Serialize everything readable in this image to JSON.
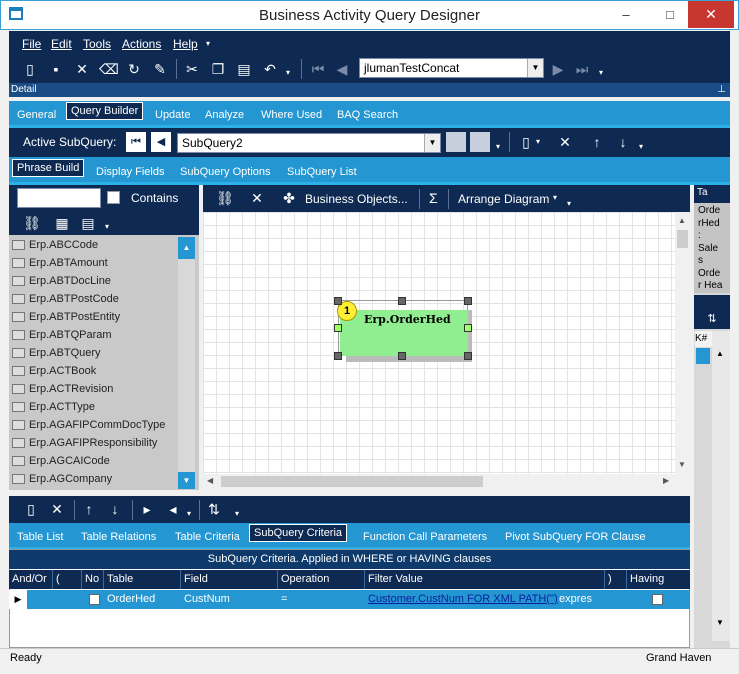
{
  "window": {
    "title": "Business Activity Query Designer",
    "minimize": "–",
    "maximize": "□",
    "close": "✕"
  },
  "menu": [
    "File",
    "Edit",
    "Tools",
    "Actions",
    "Help"
  ],
  "toolbar": {
    "query_id": "jlumanTestConcat"
  },
  "detail_label": "Detail",
  "main_tabs": [
    "General",
    "Query Builder",
    "Update",
    "Analyze",
    "Where Used",
    "BAQ Search"
  ],
  "subquery": {
    "label": "Active SubQuery:",
    "value": "SubQuery2"
  },
  "sub_tabs": [
    "Phrase Build",
    "Display Fields",
    "SubQuery Options",
    "SubQuery List"
  ],
  "left_panel": {
    "search_value": "",
    "contains_label": "Contains",
    "tables": [
      "Erp.ABCCode",
      "Erp.ABTAmount",
      "Erp.ABTDocLine",
      "Erp.ABTPostCode",
      "Erp.ABTPostEntity",
      "Erp.ABTQParam",
      "Erp.ABTQuery",
      "Erp.ACTBook",
      "Erp.ACTRevision",
      "Erp.ACTType",
      "Erp.AGAFIPCommDocType",
      "Erp.AGAFIPResponsibility",
      "Erp.AGCAICode",
      "Erp.AGCompany"
    ]
  },
  "diagram_toolbar": {
    "business_objects": "Business Objects...",
    "sigma": "Σ",
    "arrange": "Arrange Diagram"
  },
  "diagram": {
    "node_number": "1",
    "node_label": "Erp.OrderHed"
  },
  "right_panel": {
    "header": "Ta",
    "text_lines": [
      "Orde",
      "rHed",
      ":",
      "Sale",
      "s",
      "Orde",
      "r Hea"
    ],
    "col1": "K",
    "col2": "#"
  },
  "bottom_tabs": [
    "Table List",
    "Table Relations",
    "Table Criteria",
    "SubQuery Criteria",
    "Function Call Parameters",
    "Pivot SubQuery FOR Clause"
  ],
  "criteria": {
    "caption": "SubQuery Criteria. Applied in WHERE or HAVING clauses",
    "headers": [
      "And/Or",
      "(",
      "No",
      "Table",
      "Field",
      "Operation",
      "Filter Value",
      ")",
      "Having"
    ],
    "rows": [
      {
        "andor": "",
        "paren_open": "",
        "no": false,
        "table": "OrderHed",
        "field": "CustNum",
        "operation": "=",
        "filter_link": "Customer.CustNum  FOR  XML  PATH('')",
        "filter_suffix": "expres",
        "paren_close": "",
        "having": false
      }
    ]
  },
  "status": {
    "left": "Ready",
    "right": "Grand Haven"
  },
  "colors": {
    "navy": "#0e2a52",
    "accent": "#2496d2",
    "node": "#90ee90",
    "close": "#c7372f"
  }
}
